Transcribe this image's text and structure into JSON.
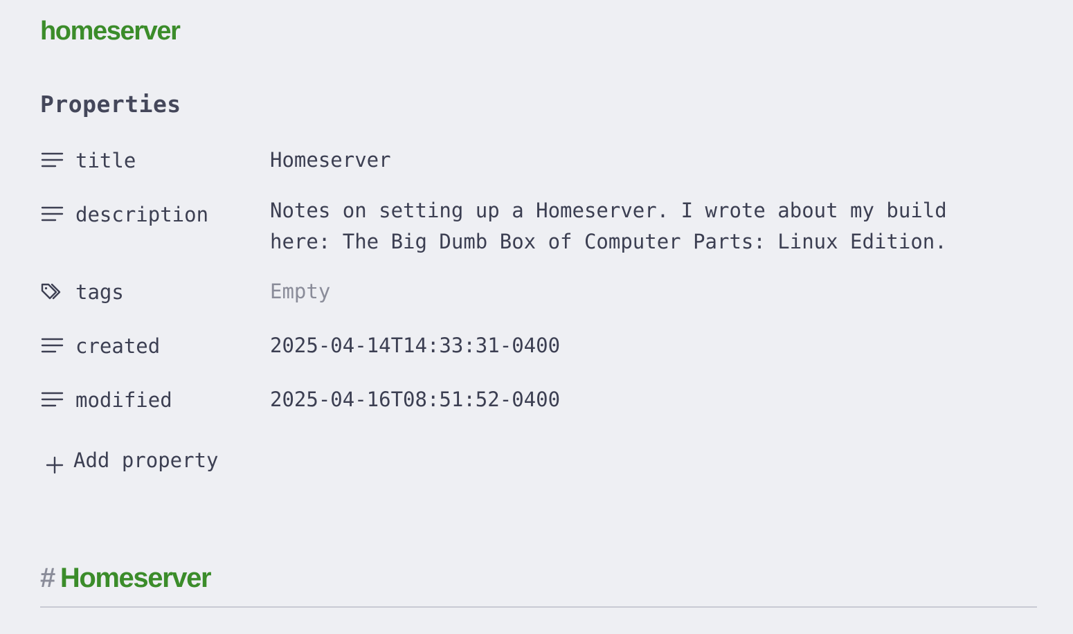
{
  "note": {
    "title": "homeserver"
  },
  "properties": {
    "heading": "Properties",
    "items": [
      {
        "icon": "text-lines-icon",
        "name": "title",
        "value": "Homeserver"
      },
      {
        "icon": "text-lines-icon",
        "name": "description",
        "value": "Notes on setting up a Homeserver. I wrote about my build here: The Big Dumb Box of Computer Parts: Linux Edition."
      },
      {
        "icon": "tag-icon",
        "name": "tags",
        "value": "Empty"
      },
      {
        "icon": "text-lines-icon",
        "name": "created",
        "value": "2025-04-14T14:33:31-0400"
      },
      {
        "icon": "text-lines-icon",
        "name": "modified",
        "value": "2025-04-16T08:51:52-0400"
      }
    ],
    "add_label": "Add property"
  },
  "body": {
    "heading_marker": "#",
    "heading": "Homeserver"
  },
  "colors": {
    "accent_green": "#3b8c2a",
    "muted_text": "#8a8c99",
    "background": "#eeeff3"
  }
}
